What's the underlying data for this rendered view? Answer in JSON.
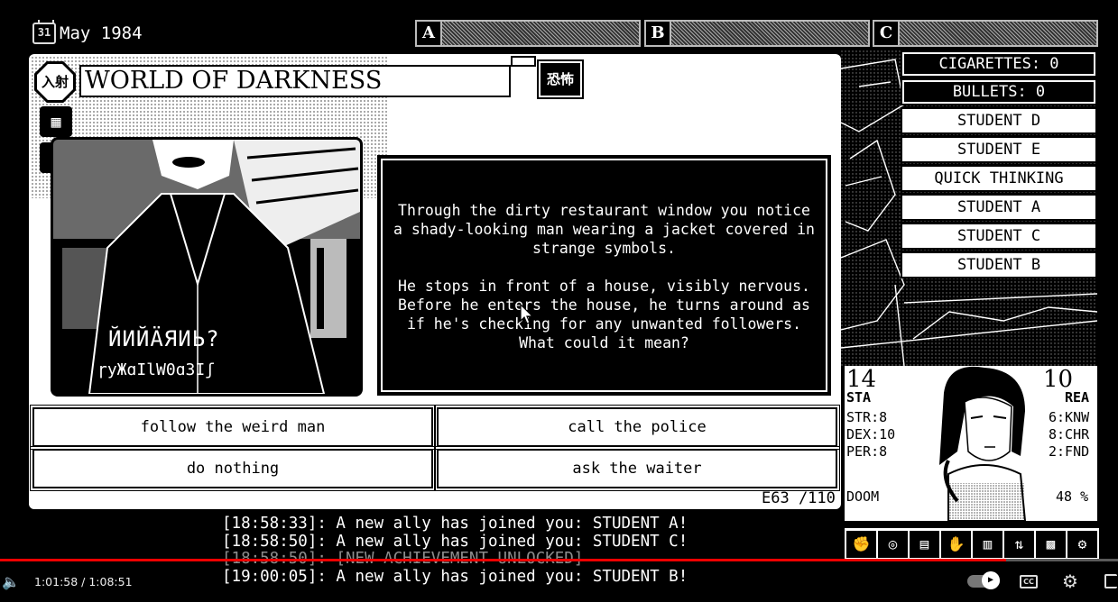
{
  "header": {
    "calendar_day": "31",
    "date": "May 1984",
    "slots": [
      "A",
      "B",
      "C"
    ]
  },
  "scene": {
    "location_badge": "入射",
    "title": "WORLD OF DARKNESS",
    "tag": "恐怖",
    "illustration_text": [
      "ЙИЙÄЯИЬ?",
      "ɼуЖɑIlW0ɑЗІʃ"
    ],
    "story": [
      "Through the dirty restaurant window you notice\na shady-looking man wearing a jacket covered in\nstrange symbols.",
      "He stops in front of a house, visibly nervous.\nBefore he enters the house, he turns around as\nif he's checking for any unwanted followers.\nWhat could it mean?"
    ],
    "choices": [
      "follow the weird man",
      "call the police",
      "do nothing",
      "ask the waiter"
    ],
    "counter": "E63 /110"
  },
  "inventory": [
    {
      "label": "CIGARETTES: 0",
      "style": "dark"
    },
    {
      "label": "BULLETS: 0",
      "style": "dark"
    },
    {
      "label": "STUDENT D",
      "style": "light"
    },
    {
      "label": "STUDENT E",
      "style": "light"
    },
    {
      "label": "QUICK THINKING",
      "style": "light"
    },
    {
      "label": "STUDENT A",
      "style": "light"
    },
    {
      "label": "STUDENT C",
      "style": "light"
    },
    {
      "label": "STUDENT B",
      "style": "light"
    }
  ],
  "character": {
    "sta_value": "14",
    "sta_label": "STA",
    "rea_value": "10",
    "rea_label": "REA",
    "left_attrs": [
      "STR:8",
      "DEX:10",
      "PER:8"
    ],
    "right_attrs": [
      "6:KNW",
      "8:CHR",
      "2:FND"
    ],
    "doom_label": "DOOM",
    "doom_value": "48 %"
  },
  "action_icons": [
    "fist-icon",
    "spiral-icon",
    "map-icon",
    "hand-icon",
    "building-icon",
    "swap-icon",
    "glyph-icon",
    "gear-icon"
  ],
  "log": [
    "[18:58:33]: A new ally has joined you: STUDENT A!",
    "[18:58:50]: A new ally has joined you: STUDENT C!",
    "[18:58:50]: [NEW ACHIEVEMENT UNLOCKED]",
    "[19:00:05]: A new ally has joined you: STUDENT B!"
  ],
  "video": {
    "time": "1:01:58 / 1:08:51",
    "progress": 0.9,
    "cc_label": "CC"
  },
  "colors": {
    "background": "#000000",
    "panel": "#ffffff",
    "progress": "#e00000"
  }
}
